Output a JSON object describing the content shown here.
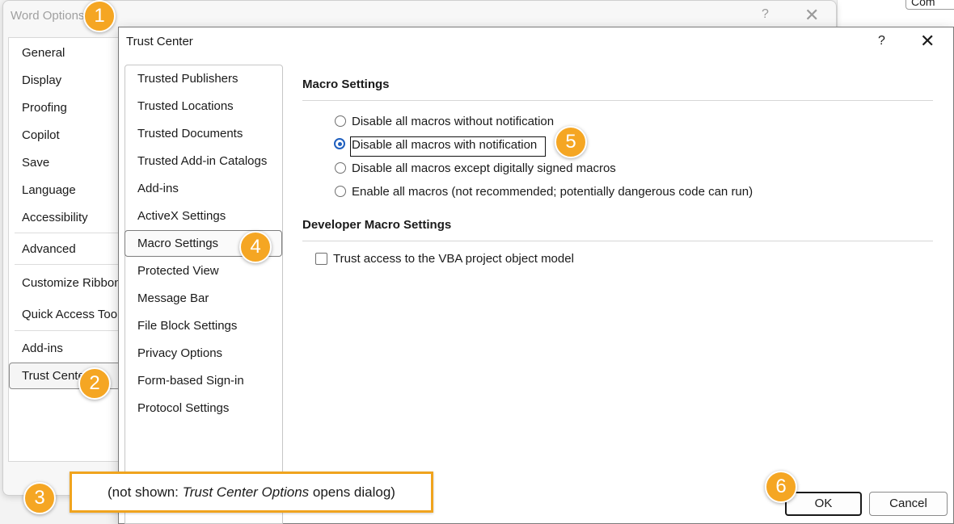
{
  "background": {
    "tab_label": "Com"
  },
  "word_options": {
    "title": "Word Options",
    "help": "?",
    "close": "✕",
    "nav": [
      {
        "label": "General"
      },
      {
        "label": "Display"
      },
      {
        "label": "Proofing"
      },
      {
        "label": "Copilot"
      },
      {
        "label": "Save"
      },
      {
        "label": "Language"
      },
      {
        "label": "Accessibility"
      },
      {
        "label": "Advanced"
      },
      {
        "label": "Customize Ribbon"
      },
      {
        "label": "Quick Access Toolbar"
      },
      {
        "label": "Add-ins"
      },
      {
        "label": "Trust Center"
      }
    ],
    "selected": "Trust Center"
  },
  "trust_center": {
    "title": "Trust Center",
    "help": "?",
    "close": "✕",
    "nav": [
      {
        "label": "Trusted Publishers"
      },
      {
        "label": "Trusted Locations"
      },
      {
        "label": "Trusted Documents"
      },
      {
        "label": "Trusted Add-in Catalogs"
      },
      {
        "label": "Add-ins"
      },
      {
        "label": "ActiveX Settings"
      },
      {
        "label": "Macro Settings"
      },
      {
        "label": "Protected View"
      },
      {
        "label": "Message Bar"
      },
      {
        "label": "File Block Settings"
      },
      {
        "label": "Privacy Options"
      },
      {
        "label": "Form-based Sign-in"
      },
      {
        "label": "Protocol Settings"
      }
    ],
    "selected": "Macro Settings",
    "macro_settings": {
      "heading": "Macro Settings",
      "options": [
        {
          "label": "Disable all macros without notification",
          "checked": false
        },
        {
          "label": "Disable all macros with notification",
          "checked": true
        },
        {
          "label": "Disable all macros except digitally signed macros",
          "checked": false
        },
        {
          "label": "Enable all macros (not recommended; potentially dangerous code can run)",
          "checked": false
        }
      ]
    },
    "developer_settings": {
      "heading": "Developer Macro Settings",
      "checkbox_label": "Trust access to the VBA project object model",
      "checked": false
    },
    "buttons": {
      "ok": "OK",
      "cancel": "Cancel"
    }
  },
  "annotations": {
    "callouts": [
      "1",
      "2",
      "3",
      "4",
      "5",
      "6"
    ],
    "note_prefix": "(not shown: ",
    "note_emphasis": "Trust Center Options",
    "note_suffix": " opens dialog)",
    "color": "#f5a623"
  }
}
